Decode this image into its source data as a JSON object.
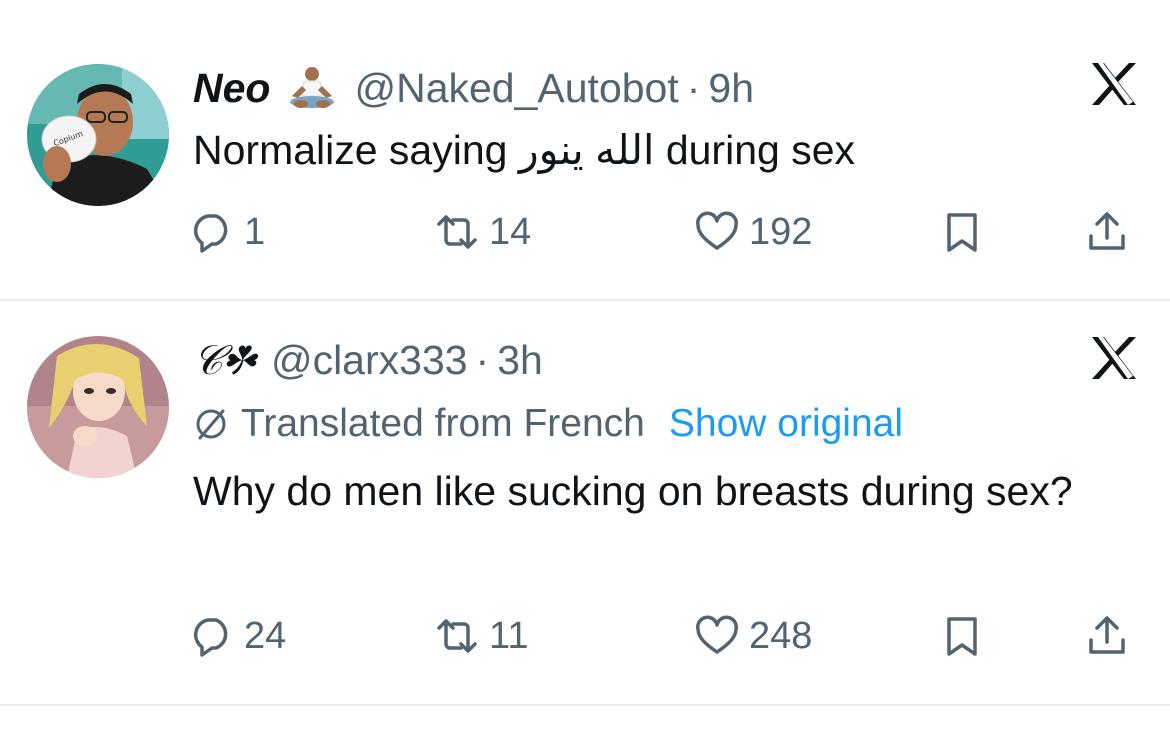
{
  "tweets": [
    {
      "display_name": "Neo",
      "emoji": "person-in-lotus-position-emoji",
      "handle": "@Naked_Autobot",
      "separator": "·",
      "time": "9h",
      "text": "Normalize saying الله ينور during sex",
      "avatar_caption": "Copium",
      "replies": "1",
      "retweets": "14",
      "likes": "192"
    },
    {
      "display_name": "𝒞☘",
      "handle": "@clarx333",
      "separator": "·",
      "time": "3h",
      "translated_label": "Translated from French",
      "show_original": "Show original",
      "text": "Why do men like sucking on breasts during sex?",
      "replies": "24",
      "retweets": "11",
      "likes": "248"
    }
  ],
  "icons": [
    "x-logo-icon",
    "reply-icon",
    "retweet-icon",
    "like-icon",
    "bookmark-icon",
    "share-icon",
    "translate-icon"
  ],
  "colors": {
    "text": "#0f1419",
    "secondary": "#536471",
    "link": "#1d9bf0",
    "divider": "#e7e9eb"
  }
}
